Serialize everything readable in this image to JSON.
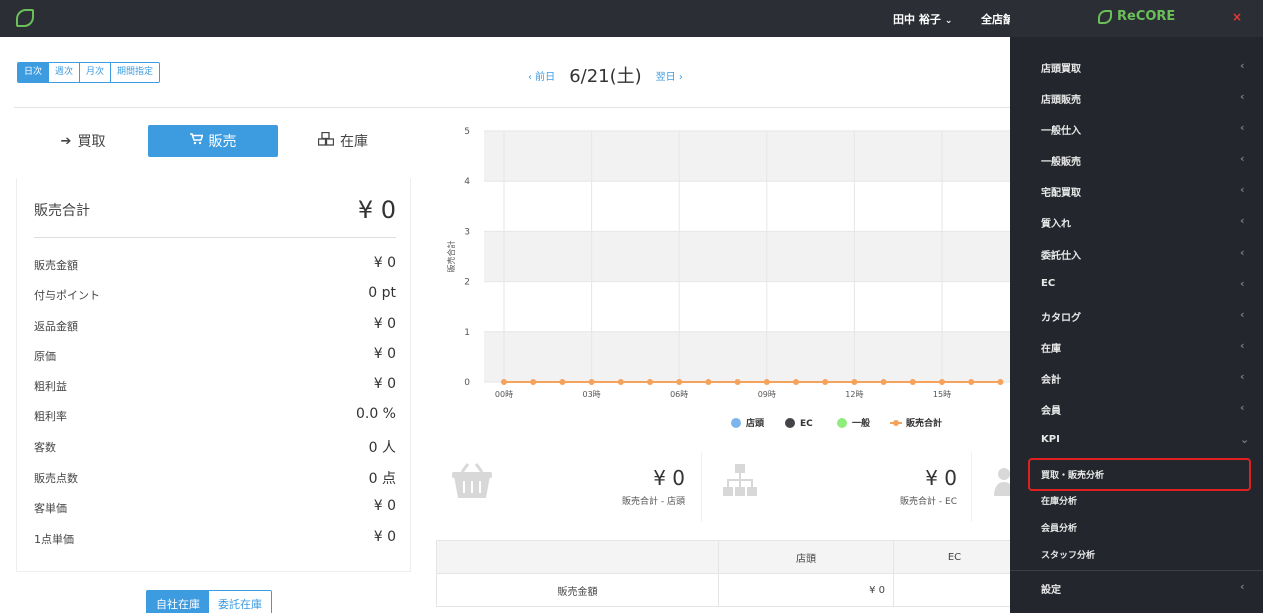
{
  "header": {
    "user_name": "田中 裕子",
    "user_caret": "⌄",
    "store_selector": "全店舗"
  },
  "period_tabs": [
    "日次",
    "週次",
    "月次",
    "期間指定"
  ],
  "date_nav": {
    "prev": "‹ 前日",
    "title": "6/21(土)",
    "next": "翌日 ›"
  },
  "mode_tabs": [
    {
      "label": "買取",
      "icon": "sign-in-icon"
    },
    {
      "label": "販売",
      "icon": "cart-icon"
    },
    {
      "label": "在庫",
      "icon": "cubes-icon"
    }
  ],
  "summary": {
    "label": "販売合計",
    "value": "¥ 0",
    "metrics": [
      {
        "label": "販売金額",
        "value": "¥ 0"
      },
      {
        "label": "付与ポイント",
        "value": "0 pt"
      },
      {
        "label": "返品金額",
        "value": "¥ 0"
      },
      {
        "label": "原価",
        "value": "¥ 0"
      },
      {
        "label": "粗利益",
        "value": "¥ 0"
      },
      {
        "label": "粗利率",
        "value": "0.0 %"
      },
      {
        "label": "客数",
        "value": "0 人"
      },
      {
        "label": "販売点数",
        "value": "0 点"
      },
      {
        "label": "客単価",
        "value": "¥ 0"
      },
      {
        "label": "1点単価",
        "value": "¥ 0"
      }
    ]
  },
  "stock_tabs": [
    "自社在庫",
    "委託在庫"
  ],
  "chart_data": {
    "type": "line",
    "x": [
      "00時",
      "01時",
      "02時",
      "03時",
      "04時",
      "05時",
      "06時",
      "07時",
      "08時",
      "09時",
      "10時",
      "11時",
      "12時",
      "13時",
      "14時",
      "15時",
      "16時",
      "17時"
    ],
    "x_tick_labels": [
      "00時",
      "03時",
      "06時",
      "09時",
      "12時",
      "15時"
    ],
    "ylabel": "販売合計",
    "ylim": [
      0,
      5
    ],
    "y_ticks": [
      "0",
      "1",
      "2",
      "3",
      "4",
      "5"
    ],
    "series": [
      {
        "name": "販売合計",
        "color": "#f5a25d",
        "values": [
          0,
          0,
          0,
          0,
          0,
          0,
          0,
          0,
          0,
          0,
          0,
          0,
          0,
          0,
          0,
          0,
          0,
          0
        ]
      }
    ],
    "legend": [
      {
        "name": "店頭",
        "color": "#7cb5ec"
      },
      {
        "name": "EC",
        "color": "#434348"
      },
      {
        "name": "一般",
        "color": "#90ed7d"
      },
      {
        "name": "販売合計",
        "color": "#f5a25d"
      }
    ],
    "legend_position": "bottom",
    "grid": true
  },
  "kpi_cards": [
    {
      "icon": "basket-icon",
      "value": "¥ 0",
      "label": "販売合計 - 店頭"
    },
    {
      "icon": "sitemap-icon",
      "value": "¥ 0",
      "label": "販売合計 - EC"
    },
    {
      "icon": "users-icon",
      "value": "",
      "label": ""
    }
  ],
  "table": {
    "headers": [
      "",
      "店頭",
      "EC"
    ],
    "rows": [
      [
        "販売金額",
        "¥ 0",
        ""
      ]
    ]
  },
  "sidebar": {
    "brand": "ReCORE",
    "close": "×",
    "items": [
      {
        "label": "店頭買取",
        "chevron": "‹"
      },
      {
        "label": "店頭販売",
        "chevron": "‹"
      },
      {
        "label": "一般仕入",
        "chevron": "‹"
      },
      {
        "label": "一般販売",
        "chevron": "‹"
      },
      {
        "label": "宅配買取",
        "chevron": "‹"
      },
      {
        "label": "質入れ",
        "chevron": "‹"
      },
      {
        "label": "委託仕入",
        "chevron": "‹"
      },
      {
        "label": "EC",
        "chevron": "‹"
      },
      {
        "label": "カタログ",
        "chevron": "‹"
      },
      {
        "label": "在庫",
        "chevron": "‹"
      },
      {
        "label": "会計",
        "chevron": "‹"
      },
      {
        "label": "会員",
        "chevron": "‹"
      },
      {
        "label": "KPI",
        "chevron": "⌄"
      }
    ],
    "kpi_subitems": [
      "買取・販売分析",
      "在庫分析",
      "会員分析",
      "スタッフ分析"
    ],
    "settings": {
      "label": "設定",
      "chevron": "‹"
    }
  },
  "colors": {
    "accent": "#3d9be0",
    "sidebar_bg": "#23272d",
    "topbar_bg": "#2b2f35",
    "brand_green": "#6bbf59",
    "highlight_red": "#e02020"
  }
}
